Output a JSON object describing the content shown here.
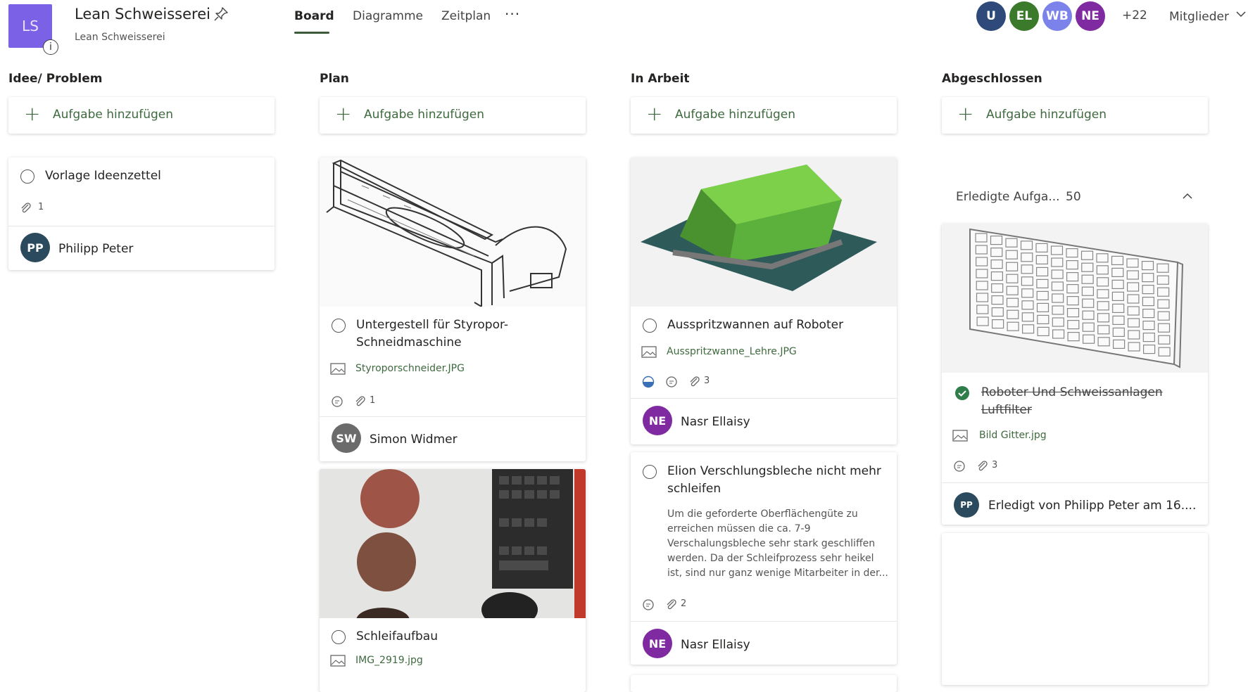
{
  "header": {
    "logo_initials": "LS",
    "info_label": "i",
    "plan_title": "Lean Schweisserei",
    "plan_subtitle": "Lean Schweisserei",
    "tabs": [
      {
        "label": "Board",
        "active": true
      },
      {
        "label": "Diagramme",
        "active": false
      },
      {
        "label": "Zeitplan",
        "active": false
      }
    ],
    "more_label": "···",
    "members": [
      {
        "initials": "U",
        "color": "#2f4a7a"
      },
      {
        "initials": "EL",
        "color": "#3a7a2a"
      },
      {
        "initials": "WB",
        "color": "#7b83eb"
      },
      {
        "initials": "NE",
        "color": "#7f2aa0"
      }
    ],
    "extra_members": "+22",
    "members_label": "Mitglieder"
  },
  "columns": [
    {
      "title": "Idee/ Problem",
      "add_label": "Aufgabe hinzufügen"
    },
    {
      "title": "Plan",
      "add_label": "Aufgabe hinzufügen"
    },
    {
      "title": "In Arbeit",
      "add_label": "Aufgabe hinzufügen"
    },
    {
      "title": "Abgeschlossen",
      "add_label": "Aufgabe hinzufügen"
    }
  ],
  "cards": {
    "vorlage": {
      "title": "Vorlage Ideenzettel",
      "attachments": "1",
      "assignee_initials": "PP",
      "assignee_name": "Philipp Peter",
      "assignee_color": "#2b4a5e"
    },
    "untergestell": {
      "title_line1": "Untergestell für Styropor-",
      "title_line2": "Schneidmaschine",
      "file": "Styroporschneider.JPG",
      "attachments": "1",
      "assignee_initials": "SW",
      "assignee_name": "Simon Widmer",
      "assignee_color": "#6b6b6b"
    },
    "schleifaufbau": {
      "title": "Schleifaufbau",
      "file": "IMG_2919.jpg"
    },
    "ausspritz": {
      "title": "Ausspritzwannen auf Roboter",
      "file": "Ausspritzwanne_Lehre.JPG",
      "attachments": "3",
      "progress": 0.5,
      "assignee_initials": "NE",
      "assignee_name": "Nasr Ellaisy",
      "assignee_color": "#7f2aa0"
    },
    "elion": {
      "title_line1": "Elion Verschlungsbleche nicht mehr",
      "title_line2": "schleifen",
      "desc_line1": "Um die geforderte Oberflächengüte zu",
      "desc_line2": "erreichen müssen die ca. 7-9",
      "desc_line3": "Verschalungsbleche sehr stark geschliffen",
      "desc_line4": "werden. Da der Schleifprozess sehr heikel",
      "desc_line5": "ist, sind nur ganz wenige Mitarbeiter in der...",
      "attachments": "2",
      "assignee_initials": "NE",
      "assignee_name": "Nasr Ellaisy",
      "assignee_color": "#7f2aa0"
    },
    "completed_section": {
      "label": "Erledigte Aufga...",
      "count": "50"
    },
    "roboter": {
      "title_line1": "Roboter Und Schweissanlagen",
      "title_line2": "Luftfilter",
      "file": "Bild Gitter.jpg",
      "attachments": "3",
      "completed_by_initials": "PP",
      "completed_by_text": "Erledigt von Philipp Peter am 16....",
      "completed_by_color": "#2b4a5e"
    }
  },
  "colors": {
    "accent_green": "#3f6a3f",
    "check_green": "#2e7d4a",
    "logo_purple": "#7b61e5"
  }
}
